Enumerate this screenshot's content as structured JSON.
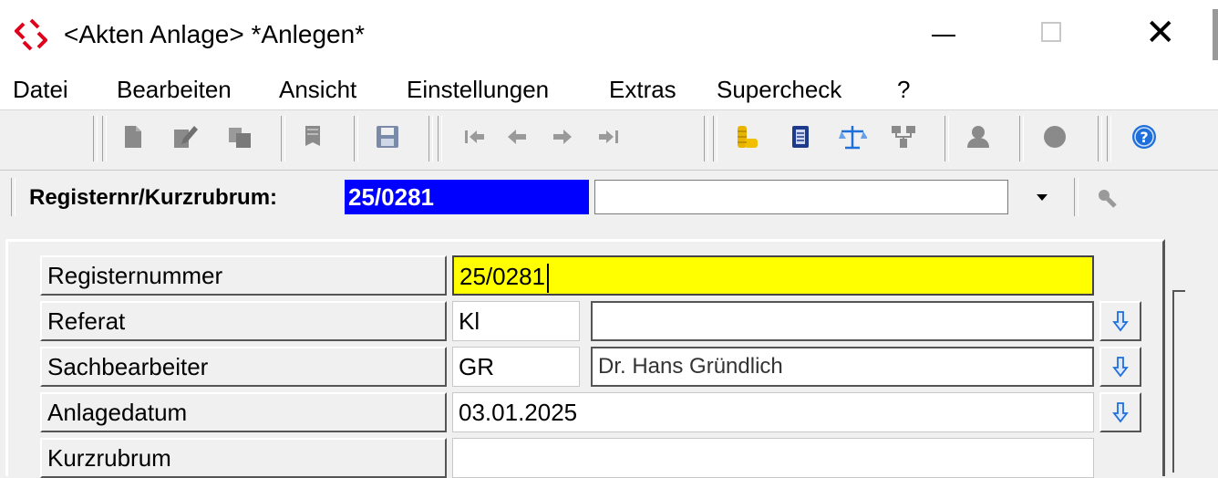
{
  "window": {
    "title": "<Akten Anlage> *Anlegen*",
    "close_glyph": "✕"
  },
  "menu": [
    "Datei",
    "Bearbeiten",
    "Ansicht",
    "Einstellungen",
    "Extras",
    "Supercheck",
    "?"
  ],
  "toolbar": {
    "icons": [
      "new-document-icon",
      "edit-document-icon",
      "copy-document-icon",
      "delete-document-icon",
      "save-icon",
      "first-record-icon",
      "previous-record-icon",
      "next-record-icon",
      "last-record-icon",
      "coins-icon",
      "notebook-icon",
      "scales-icon",
      "organization-icon",
      "person-icon",
      "record-dot-icon",
      "help-icon"
    ]
  },
  "register_bar": {
    "label": "Registernr/Kurzrubrum:",
    "value": "25/0281",
    "combo_value": ""
  },
  "form": {
    "fields": [
      {
        "label": "Registernummer",
        "value": "25/0281"
      },
      {
        "label": "Referat",
        "value": "Kl",
        "description": ""
      },
      {
        "label": "Sachbearbeiter",
        "value": "GR",
        "description": "Dr. Hans Gründlich"
      },
      {
        "label": "Anlagedatum",
        "value": "03.01.2025"
      },
      {
        "label": "Kurzrubrum",
        "value": ""
      }
    ]
  },
  "colors": {
    "register_highlight": "#0000ff",
    "focused_field": "#ffff00",
    "icon_gray": "#8a8a8a",
    "accent_blue": "#1e6fd9",
    "coins_gold": "#e8b400"
  }
}
